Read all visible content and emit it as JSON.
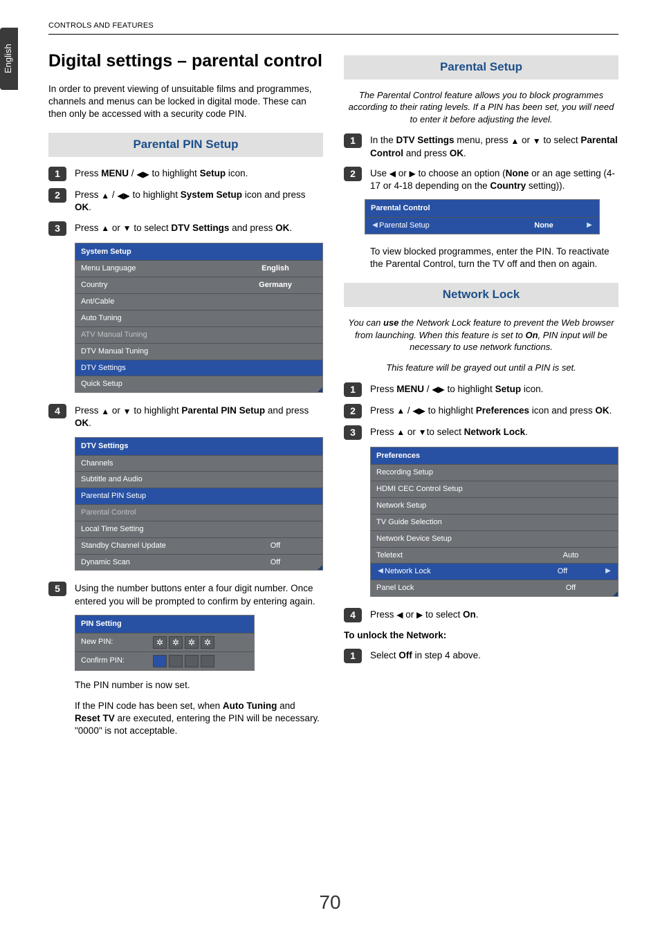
{
  "side_tab": "English",
  "header": "CONTROLS AND FEATURES",
  "page_number": "70",
  "left": {
    "title": "Digital settings – parental control",
    "intro": "In order to prevent viewing of unsuitable films and programmes, channels and menus can be locked in digital mode. These can then only be accessed with a security code PIN.",
    "section1_title": "Parental PIN Setup",
    "s1_pre": "Press ",
    "s1_menu": "MENU",
    "s1_mid": " / ",
    "s1_post": " to highlight ",
    "s1_setup": "Setup",
    "s1_icon": " icon.",
    "s2_pre": "Press ",
    "s2_mid": " / ",
    "s2_post": " to highlight ",
    "s2_target": "System Setup",
    "s2_tail": " icon and press ",
    "ok": "OK",
    "period": ".",
    "s3_pre": "Press ",
    "s3_or": " or ",
    "s3_post": " to select ",
    "s3_target": "DTV Settings",
    "s3_tail": " and press ",
    "menu1": {
      "header": "System Setup",
      "rows": [
        {
          "label": "Menu Language",
          "value": "English"
        },
        {
          "label": "Country",
          "value": "Germany"
        },
        {
          "label": "Ant/Cable",
          "value": ""
        },
        {
          "label": "Auto Tuning",
          "value": ""
        },
        {
          "label": "ATV Manual Tuning",
          "value": "",
          "dim": true
        },
        {
          "label": "DTV Manual Tuning",
          "value": ""
        },
        {
          "label": "DTV Settings",
          "value": "",
          "sel": true
        },
        {
          "label": "Quick Setup",
          "value": "",
          "corner": true
        }
      ]
    },
    "s4_pre": "Press ",
    "s4_or": " or ",
    "s4_post": " to highlight ",
    "s4_target": "Parental PIN Setup",
    "s4_tail": " and press ",
    "menu2": {
      "header": "DTV Settings",
      "rows": [
        {
          "label": "Channels",
          "value": ""
        },
        {
          "label": "Subtitle and Audio",
          "value": ""
        },
        {
          "label": "Parental PIN Setup",
          "value": "",
          "sel": true
        },
        {
          "label": "Parental Control",
          "value": "",
          "dim": true
        },
        {
          "label": "Local Time Setting",
          "value": ""
        },
        {
          "label": "Standby Channel Update",
          "value": "Off"
        },
        {
          "label": "Dynamic Scan",
          "value": "Off",
          "corner": true
        }
      ]
    },
    "s5": "Using the number buttons enter a four digit number. Once entered you will be prompted to confirm by entering again.",
    "pin": {
      "header": "PIN Setting",
      "new": "New PIN:",
      "confirm": "Confirm PIN:",
      "star": "✲"
    },
    "after_pin": "The PIN number is now set.",
    "note_pre": "If the PIN code has been set, when ",
    "note_at": "Auto Tuning",
    "note_mid": " and ",
    "note_rt": "Reset TV",
    "note_tail": " are executed, entering the PIN will be necessary. \"0000\" is not acceptable."
  },
  "right": {
    "section1_title": "Parental Setup",
    "intro": "The Parental Control feature allows you to block programmes according to their rating levels. If a PIN has been set, you will need to enter it before adjusting the level.",
    "r1_pre": "In the ",
    "r1_dtv": "DTV Settings",
    "r1_mid": " menu, press ",
    "r1_or": " or ",
    "r1_post": " to select ",
    "r1_target": "Parental Control",
    "r1_tail": " and press ",
    "r2_pre": "Use ",
    "r2_or": " or ",
    "r2_post": " to choose an option (",
    "none": "None",
    "r2_mid2": " or an age setting (4-17 or 4-18 depending on the ",
    "country": "Country",
    "r2_tail": " setting)).",
    "menu_pc": {
      "header": "Parental Control",
      "row_label": "Parental Setup",
      "row_value": "None"
    },
    "after_pc": "To view blocked programmes, enter the PIN. To reactivate the Parental Control, turn the TV off and then on again.",
    "section2_title": "Network Lock",
    "nl_intro_pre": "You can ",
    "nl_use": "use",
    "nl_intro_mid": " the Network Lock feature to prevent the Web browser from launching. When this feature is set to ",
    "nl_on": "On",
    "nl_intro_tail": ", PIN input will be necessary to use network functions.",
    "nl_gray": "This feature will be grayed out until a PIN is set.",
    "nl1_pre": "Press ",
    "nl1_menu": "MENU",
    "nl1_mid": " / ",
    "nl1_post": " to highlight ",
    "nl1_setup": "Setup",
    "nl1_tail": " icon.",
    "nl2_pre": "Press ",
    "nl2_mid": " / ",
    "nl2_post": " to highlight ",
    "nl2_target": "Preferences",
    "nl2_tail": " icon and press ",
    "nl3_pre": "Press ",
    "nl3_or": " or ",
    "nl3_post": "to select ",
    "nl3_target": "Network Lock",
    "menu_pref": {
      "header": "Preferences",
      "rows": [
        {
          "label": "Recording Setup",
          "value": ""
        },
        {
          "label": "HDMI CEC Control Setup",
          "value": ""
        },
        {
          "label": "Network Setup",
          "value": ""
        },
        {
          "label": "TV Guide Selection",
          "value": ""
        },
        {
          "label": "Network Device Setup",
          "value": ""
        },
        {
          "label": "Teletext",
          "value": "Auto"
        },
        {
          "label": "Network Lock",
          "value": "Off",
          "sel": true,
          "chev": true
        },
        {
          "label": "Panel Lock",
          "value": "Off",
          "corner": true
        }
      ]
    },
    "nl4_pre": "Press ",
    "nl4_or": " or ",
    "nl4_post": " to select ",
    "nl4_on": "On",
    "unlock_head": "To unlock the Network:",
    "unlock_pre": "Select ",
    "unlock_off": "Off",
    "unlock_tail": " in step 4 above."
  }
}
